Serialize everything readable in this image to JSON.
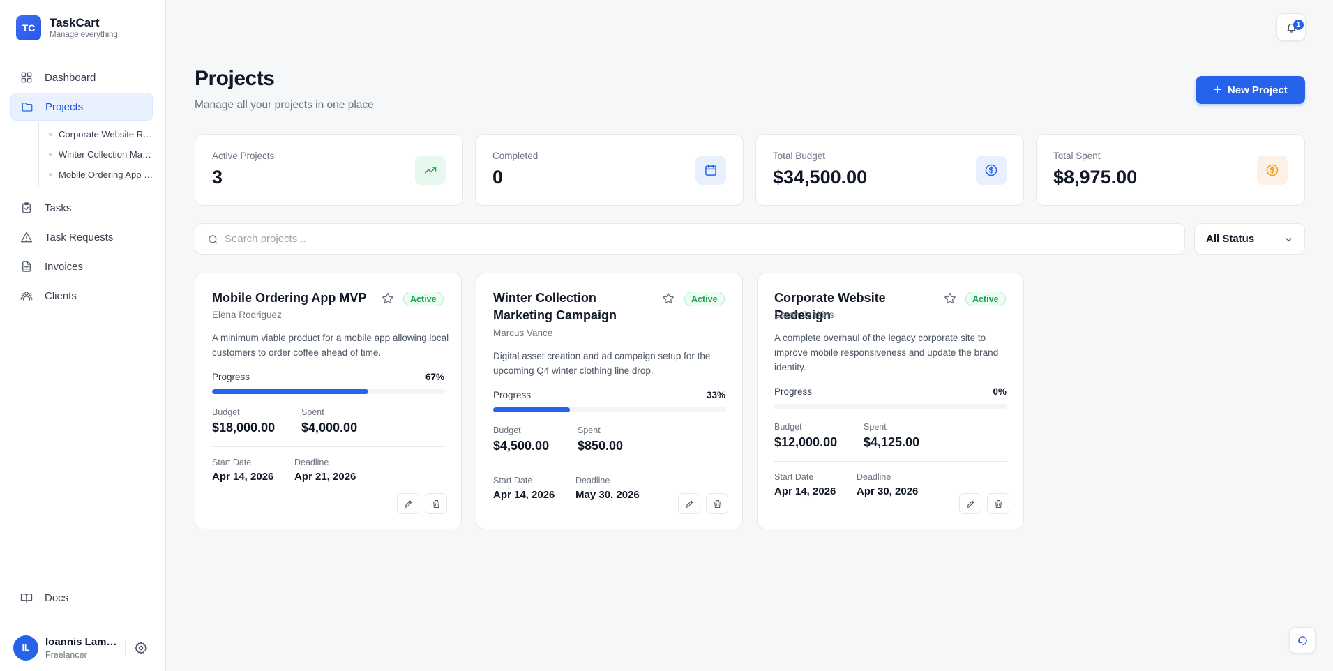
{
  "app": {
    "logo": "TC",
    "name": "TaskCart",
    "tagline": "Manage everything"
  },
  "nav": {
    "dashboard": "Dashboard",
    "projects": "Projects",
    "project_items": [
      "Corporate Website Redesign",
      "Winter Collection Marketing Campaign",
      "Mobile Ordering App MVP"
    ],
    "tasks": "Tasks",
    "task_requests": "Task Requests",
    "invoices": "Invoices",
    "clients": "Clients",
    "docs": "Docs"
  },
  "user": {
    "initials": "IL",
    "name": "Ioannis Lampropoulos",
    "role": "Freelancer"
  },
  "notifications": {
    "count": "1"
  },
  "header": {
    "title": "Projects",
    "subtitle": "Manage all your projects in one place",
    "new_button": "New Project"
  },
  "stats": [
    {
      "label": "Active Projects",
      "value": "3",
      "icon": "trending-up-icon",
      "bg": "#e7f8ee",
      "color": "#16a34a"
    },
    {
      "label": "Completed",
      "value": "0",
      "icon": "calendar-icon",
      "bg": "#e8f0fd",
      "color": "#2563eb"
    },
    {
      "label": "Total Budget",
      "value": "$34,500.00",
      "icon": "dollar-circle-icon",
      "bg": "#e8f0fd",
      "color": "#2563eb"
    },
    {
      "label": "Total Spent",
      "value": "$8,975.00",
      "icon": "dollar-circle-icon",
      "bg": "#fdf0e6",
      "color": "#f59e0b"
    }
  ],
  "search": {
    "placeholder": "Search projects..."
  },
  "filter": {
    "selected": "All Status"
  },
  "labels": {
    "progress": "Progress",
    "budget": "Budget",
    "spent": "Spent",
    "start_date": "Start Date",
    "deadline": "Deadline"
  },
  "projects": [
    {
      "title": "Mobile Ordering App MVP",
      "status": "Active",
      "owner": "Elena Rodriguez",
      "description": "A minimum viable product for a mobile app allowing local customers to order coffee ahead of time.",
      "progress_text": "67%",
      "progress": 0.67,
      "budget": "$18,000.00",
      "spent": "$4,000.00",
      "start_date": "Apr 14, 2026",
      "deadline": "Apr 21, 2026"
    },
    {
      "title": "Winter Collection Marketing Campaign",
      "status": "Active",
      "owner": "Marcus Vance",
      "description": "Digital asset creation and ad campaign setup for the upcoming Q4 winter clothing line drop.",
      "progress_text": "33%",
      "progress": 0.33,
      "budget": "$4,500.00",
      "spent": "$850.00",
      "start_date": "Apr 14, 2026",
      "deadline": "May 30, 2026"
    },
    {
      "title": "Corporate Website Redesign",
      "status": "Active",
      "owner": "Sarah Jenkins",
      "description": "A complete overhaul of the legacy corporate site to improve mobile responsiveness and update the brand identity.",
      "progress_text": "0%",
      "progress": 0.0,
      "budget": "$12,000.00",
      "spent": "$4,125.00",
      "start_date": "Apr 14, 2026",
      "deadline": "Apr 30, 2026"
    }
  ]
}
